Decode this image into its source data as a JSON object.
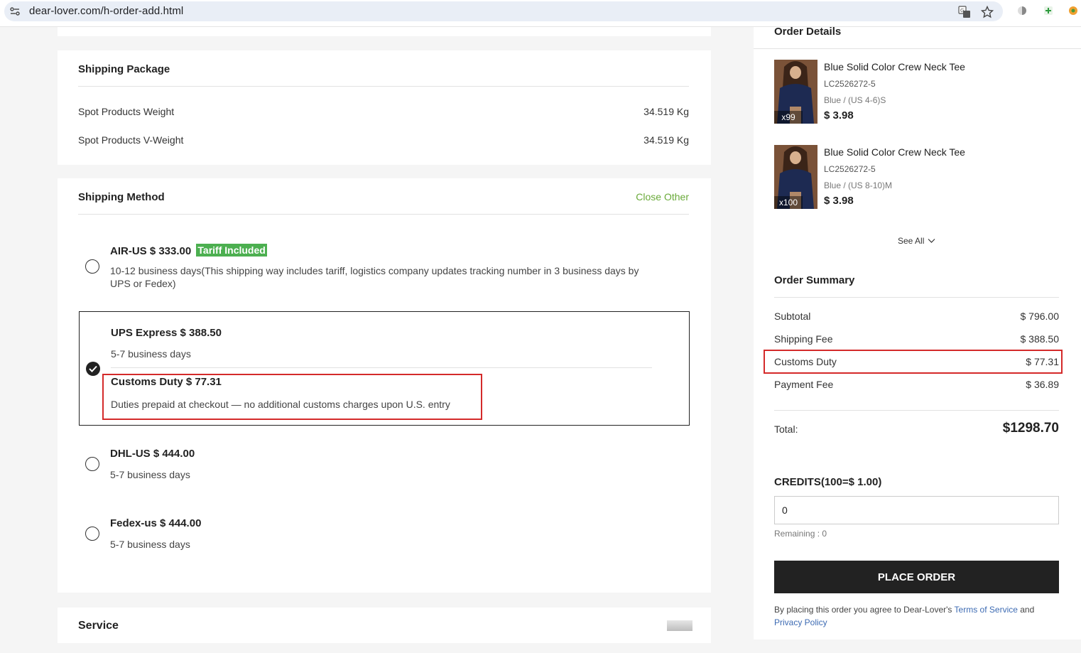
{
  "browser": {
    "url": "dear-lover.com/h-order-add.html"
  },
  "shipping_package": {
    "title": "Shipping Package",
    "rows": [
      {
        "label": "Spot Products Weight",
        "value": "34.519 Kg"
      },
      {
        "label": "Spot Products V-Weight",
        "value": "34.519 Kg"
      }
    ]
  },
  "shipping_method": {
    "title": "Shipping Method",
    "close_other": "Close Other",
    "options": [
      {
        "name": "AIR-US $ 333.00",
        "badge": "Tariff Included",
        "desc": "10-12 business days(This shipping way includes tariff, logistics company updates tracking number in 3 business days by UPS or Fedex)",
        "selected": false
      },
      {
        "name": "UPS Express $ 388.50",
        "desc": "5-7 business days",
        "selected": true,
        "customs_title": "Customs Duty $ 77.31",
        "customs_desc": "Duties prepaid at checkout — no additional customs charges upon U.S. entry"
      },
      {
        "name": "DHL-US $ 444.00",
        "desc": "5-7 business days",
        "selected": false
      },
      {
        "name": "Fedex-us $ 444.00",
        "desc": "5-7 business days",
        "selected": false
      }
    ]
  },
  "service": {
    "title": "Service"
  },
  "order_details": {
    "title": "Order Details",
    "items": [
      {
        "name": "Blue Solid Color Crew Neck Tee",
        "sku": "LC2526272-5",
        "variant": "Blue / (US 4-6)S",
        "price": "$ 3.98",
        "qty": "x99"
      },
      {
        "name": "Blue Solid Color Crew Neck Tee",
        "sku": "LC2526272-5",
        "variant": "Blue / (US 8-10)M",
        "price": "$ 3.98",
        "qty": "x100"
      }
    ],
    "see_all": "See All"
  },
  "order_summary": {
    "title": "Order Summary",
    "subtotal_label": "Subtotal",
    "subtotal": "$ 796.00",
    "shipping_label": "Shipping Fee",
    "shipping": "$ 388.50",
    "customs_label": "Customs Duty",
    "customs": "$ 77.31",
    "payment_label": "Payment Fee",
    "payment": "$ 36.89",
    "total_label": "Total:",
    "total": "$1298.70"
  },
  "credits": {
    "title": "CREDITS(100=$ 1.00)",
    "value": "0",
    "remaining": "Remaining : 0"
  },
  "place_order": "PLACE ORDER",
  "legal": {
    "prefix": "By placing this order you agree to Dear-Lover's ",
    "terms": "Terms of Service",
    "and": " and",
    "privacy": "Privacy Policy"
  },
  "colors": {
    "accent_green": "#4caf50",
    "link_blue": "#3d6bb3",
    "highlight_red": "#d42a2a"
  }
}
